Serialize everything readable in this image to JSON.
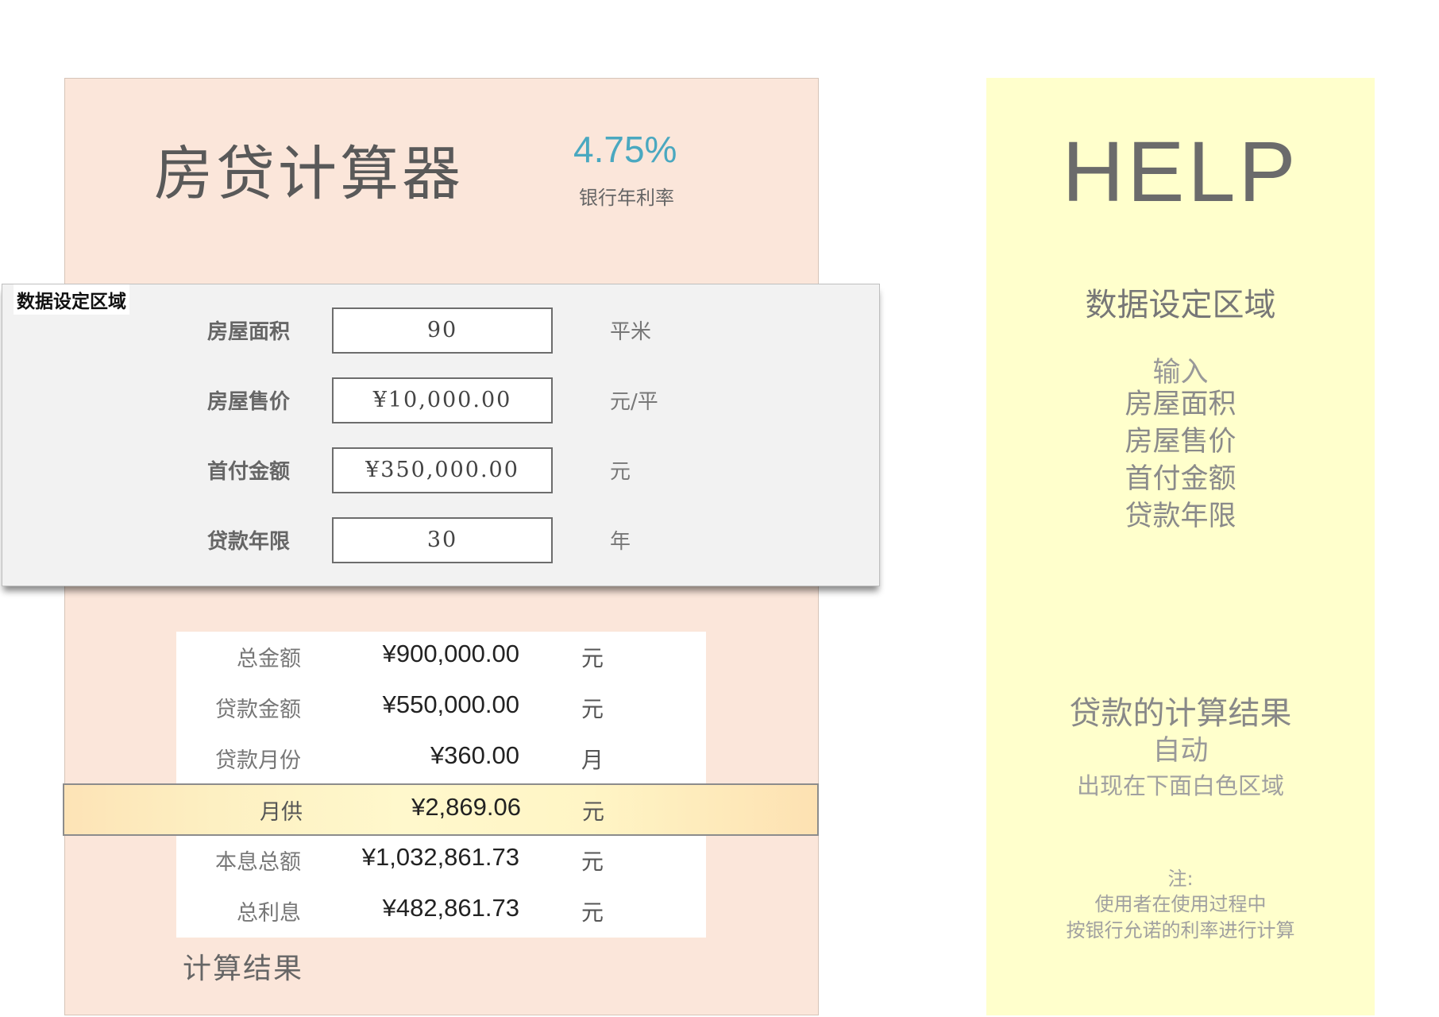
{
  "header": {
    "title": "房贷计算器",
    "rate_value": "4.75%",
    "rate_label": "银行年利率"
  },
  "input_region": {
    "label": "数据设定区域",
    "rows": [
      {
        "label": "房屋面积",
        "value": "90",
        "unit": "平米"
      },
      {
        "label": "房屋售价",
        "value": "¥10,000.00",
        "unit": "元/平"
      },
      {
        "label": "首付金额",
        "value": "¥350,000.00",
        "unit": "元"
      },
      {
        "label": "贷款年限",
        "value": "30",
        "unit": "年"
      }
    ]
  },
  "results": {
    "rows": [
      {
        "label": "总金额",
        "value": "¥900,000.00",
        "unit": "元"
      },
      {
        "label": "贷款金额",
        "value": "¥550,000.00",
        "unit": "元"
      },
      {
        "label": "贷款月份",
        "value": "¥360.00",
        "unit": "月"
      },
      {
        "label": "月供",
        "value": "¥2,869.06",
        "unit": "元"
      },
      {
        "label": "本息总额",
        "value": "¥1,032,861.73",
        "unit": "元"
      },
      {
        "label": "总利息",
        "value": "¥482,861.73",
        "unit": "元"
      }
    ],
    "caption": "计算结果"
  },
  "help": {
    "title": "HELP",
    "input_heading": "数据设定区域",
    "input_verb": "输入",
    "input_items": [
      "房屋面积",
      "房屋售价",
      "首付金额",
      "贷款年限"
    ],
    "result_heading": "贷款的计算结果",
    "result_auto": "自动",
    "result_where": "出现在下面白色区域",
    "note_title": "注:",
    "note_line1": "使用者在使用过程中",
    "note_line2": "按银行允诺的利率进行计算"
  },
  "colors": {
    "calc_panel_bg": "#fbe6da",
    "help_panel_bg": "#ffffcc",
    "rate_accent": "#4aa8c0",
    "input_region_bg": "#f2f2f2",
    "highlight_row": "#fff5c5"
  }
}
